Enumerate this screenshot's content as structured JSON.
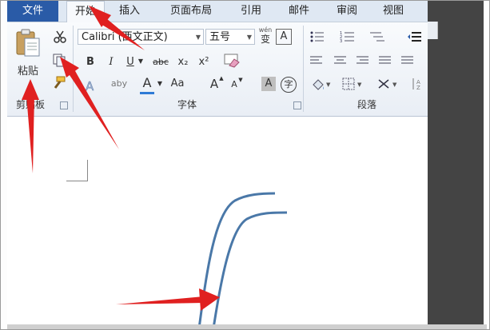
{
  "tabs": [
    {
      "label": "文件"
    },
    {
      "label": "开始"
    },
    {
      "label": "插入"
    },
    {
      "label": "页面布局"
    },
    {
      "label": "引用"
    },
    {
      "label": "邮件"
    },
    {
      "label": "审阅"
    },
    {
      "label": "视图"
    }
  ],
  "clipboard": {
    "paste_label": "粘贴",
    "group_label": "剪贴板"
  },
  "font": {
    "font_name": "Calibri (西文正文)",
    "font_size": "五号",
    "group_label": "字体",
    "bold": "B",
    "italic": "I",
    "underline": "U",
    "strike": "abc",
    "subscript": "x₂",
    "superscript": "x²",
    "grow": "A",
    "shrink": "A",
    "case": "Aa",
    "wen_label": "wén",
    "wen_char": "变",
    "border_char": "A",
    "enclose_char": "字",
    "shade_char": "A",
    "highlight": "aby",
    "color_char": "A"
  },
  "paragraph": {
    "group_label": "段落"
  },
  "colors": {
    "file_tab": "#2a5ba7",
    "arrow_red": "#e02020",
    "curve_blue": "#4a78a8",
    "font_color_bar": "#2e7bd6"
  }
}
